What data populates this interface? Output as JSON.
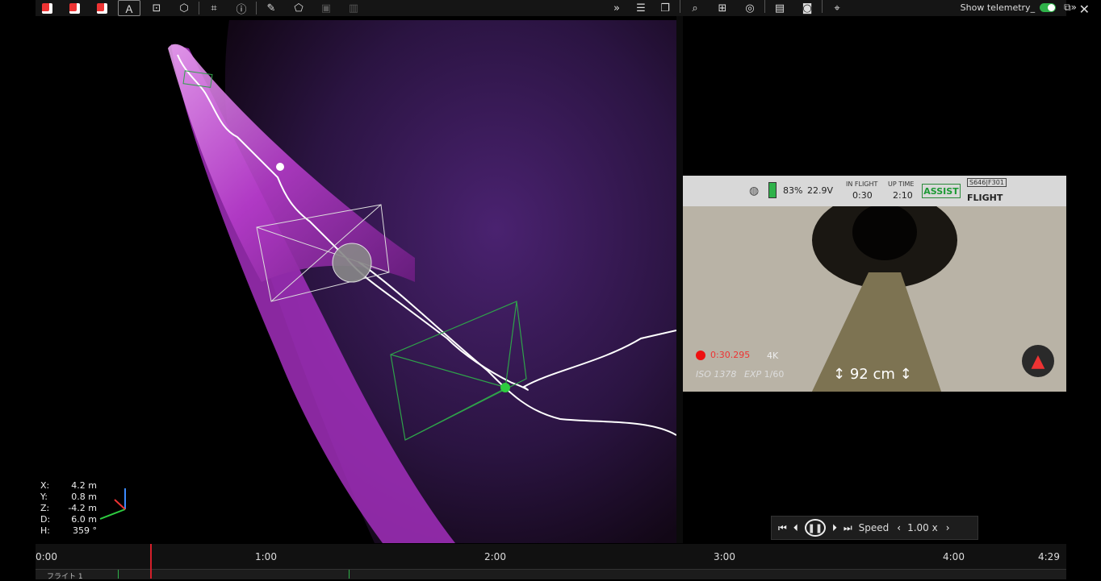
{
  "toolbar": {
    "left_icons": [
      "view-cube-front-icon",
      "view-cube-side-icon",
      "view-cube-top-icon",
      "text-tool-icon",
      "snapshot-icon",
      "3d-box-icon",
      "crop-icon",
      "help-icon",
      "pencil-icon",
      "polygon-icon",
      "save-icon",
      "trash-icon"
    ],
    "right_icons": [
      "double-chevron-right-icon",
      "sliders-icon",
      "windows-icon",
      "zoom-icon",
      "export-icon",
      "rgb-icon",
      "clipboard-icon",
      "camera-icon",
      "location-pin-icon"
    ],
    "show_telemetry_label": "Show telemetry_",
    "show_telemetry_on": true
  },
  "coords": [
    {
      "k": "X:",
      "v": "4.2 m"
    },
    {
      "k": "Y:",
      "v": "0.8 m"
    },
    {
      "k": "Z:",
      "v": "-4.2 m"
    },
    {
      "k": "D:",
      "v": "6.0 m"
    },
    {
      "k": "H:",
      "v": "359 °"
    }
  ],
  "video_hud": {
    "battery_pct": "83%",
    "voltage": "22.9V",
    "in_flight_label": "IN FLIGHT",
    "in_flight_time": "0:30",
    "uptime_label": "UP TIME",
    "uptime_time": "2:10",
    "assist": "ASSIST",
    "code": "S646|F301",
    "mode": "FLIGHT",
    "rec_time": "0:30.295",
    "resolution": "4K",
    "iso": "ISO 1378",
    "exp_label": "EXP",
    "exp_value": "1/60",
    "distance": "92 cm"
  },
  "playback": {
    "speed_label": "Speed",
    "speed_value": "1.00 x"
  },
  "timeline": {
    "ticks": [
      "0:00",
      "1:00",
      "2:00",
      "3:00",
      "4:00",
      "4:29"
    ],
    "track_label": "フライト 1"
  },
  "colors": {
    "accent_green": "#2fb24a",
    "playhead": "#d41f2a",
    "cloud": "#b040c8"
  }
}
